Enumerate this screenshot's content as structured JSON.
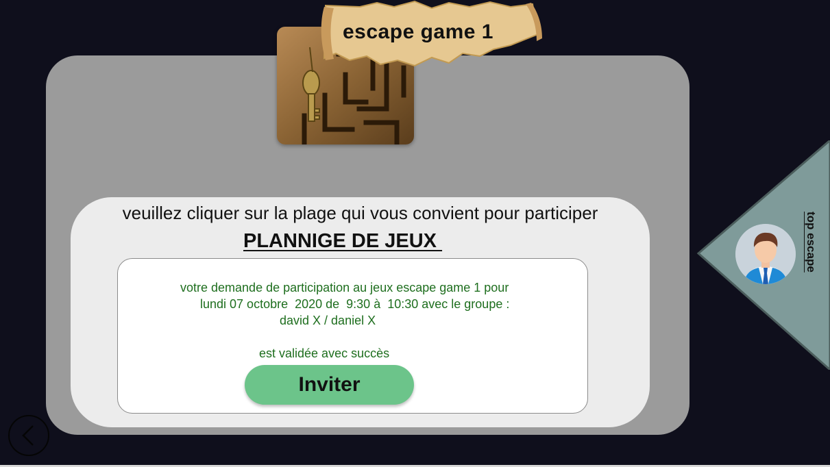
{
  "header": {
    "game_title": "escape game 1"
  },
  "main": {
    "instruction": "veuillez cliquer sur la plage qui vous convient pour participer",
    "planning_title": "PLANNIGE DE JEUX ",
    "confirmation": {
      "line1": "votre demande de participation au jeux escape game 1 pour",
      "line2": "lundi 07 octobre  2020 de  9:30 à  10:30 avec le groupe :",
      "line3": "david X / daniel X",
      "success": "est validée avec succès"
    },
    "invite_label": "Inviter"
  },
  "side_panel": {
    "link_label": "top escape"
  },
  "colors": {
    "background": "#0f0f1c",
    "card": "#9b9b9b",
    "inner_panel": "#ececec",
    "confirm_text": "#1e6e1e",
    "invite_button": "#6cc48a",
    "side_panel": "#7f9b9a"
  },
  "icons": {
    "back": "chevron-left-icon",
    "avatar": "user-avatar-icon"
  }
}
